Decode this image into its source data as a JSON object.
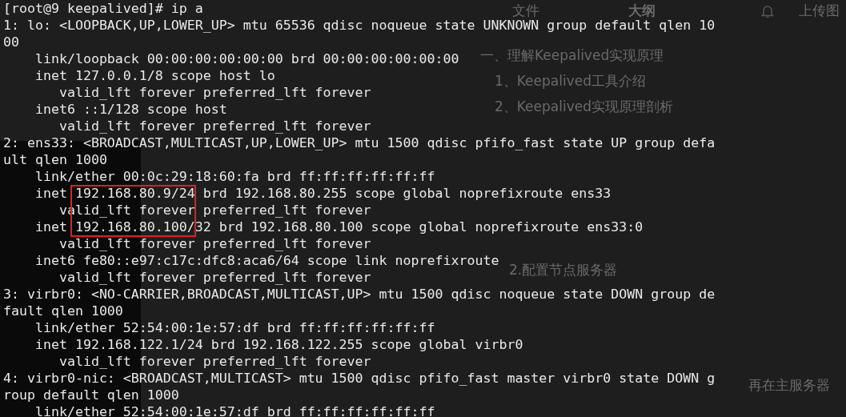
{
  "background_window": {
    "items": [
      {
        "text": "文件",
        "bold": false
      },
      {
        "text": "大纲",
        "bold": true
      },
      {
        "text": "上传图",
        "bold": false
      },
      {
        "text": "一、理解Keepalived实现原理",
        "bold": false
      },
      {
        "text": "1、Keepalived工具介绍",
        "bold": false
      },
      {
        "text": "2、Keepalived实现原理剖析",
        "bold": false
      },
      {
        "text": "2.配置节点服务器",
        "bold": false
      },
      {
        "text": "再在主服务器",
        "bold": false
      }
    ]
  },
  "terminal": {
    "lines": [
      "[root@9 keepalived]# ip a",
      "1: lo: <LOOPBACK,UP,LOWER_UP> mtu 65536 qdisc noqueue state UNKNOWN group default qlen 10",
      "00",
      "    link/loopback 00:00:00:00:00:00 brd 00:00:00:00:00:00",
      "    inet 127.0.0.1/8 scope host lo",
      "       valid_lft forever preferred_lft forever",
      "    inet6 ::1/128 scope host",
      "       valid_lft forever preferred_lft forever",
      "2: ens33: <BROADCAST,MULTICAST,UP,LOWER_UP> mtu 1500 qdisc pfifo_fast state UP group defa",
      "ult qlen 1000",
      "    link/ether 00:0c:29:18:60:fa brd ff:ff:ff:ff:ff:ff",
      "    inet 192.168.80.9/24 brd 192.168.80.255 scope global noprefixroute ens33",
      "       valid_lft forever preferred_lft forever",
      "    inet 192.168.80.100/32 brd 192.168.80.100 scope global noprefixroute ens33:0",
      "       valid_lft forever preferred_lft forever",
      "    inet6 fe80::e97:c17c:dfc8:aca6/64 scope link noprefixroute",
      "       valid_lft forever preferred_lft forever",
      "3: virbr0: <NO-CARRIER,BROADCAST,MULTICAST,UP> mtu 1500 qdisc noqueue state DOWN group de",
      "fault qlen 1000",
      "    link/ether 52:54:00:1e:57:df brd ff:ff:ff:ff:ff:ff",
      "    inet 192.168.122.1/24 brd 192.168.122.255 scope global virbr0",
      "       valid_lft forever preferred_lft forever",
      "4: virbr0-nic: <BROADCAST,MULTICAST> mtu 1500 qdisc pfifo_fast master virbr0 state DOWN g",
      "roup default qlen 1000",
      "    link/ether 52:54:00:1e:57:df brd ff:ff:ff:ff:ff:ff"
    ]
  }
}
